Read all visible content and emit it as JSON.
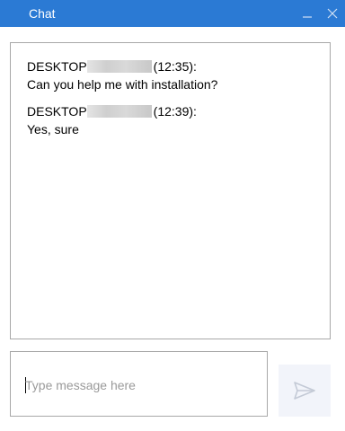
{
  "window": {
    "title": "Chat",
    "minimize_icon": "minimize-icon",
    "close_icon": "close-icon",
    "accent_color": "#2b7ad4"
  },
  "messages": [
    {
      "sender": "DESKTOP",
      "sender_redacted": true,
      "time": "(12:35):",
      "text": "Can you help me with installation?"
    },
    {
      "sender": "DESKTOP",
      "sender_redacted": true,
      "time": "(12:39):",
      "text": "Yes, sure"
    }
  ],
  "composer": {
    "placeholder": "Type message here",
    "value": "",
    "send_icon": "send-icon"
  }
}
